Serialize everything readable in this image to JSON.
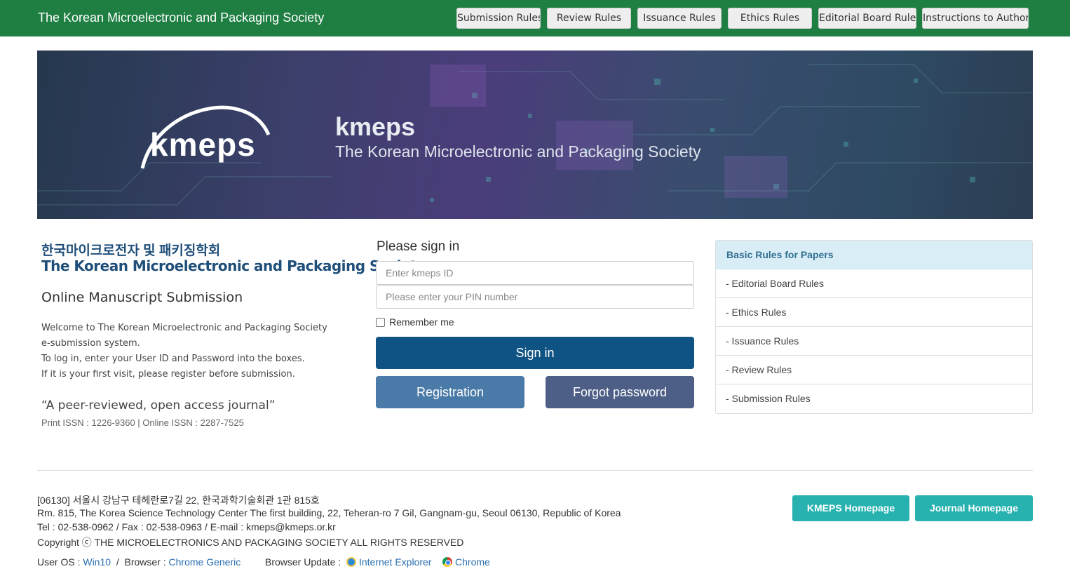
{
  "header": {
    "site_title": "The Korean Microelectronic and Packaging Society",
    "nav": [
      {
        "label": "Submission Rules"
      },
      {
        "label": "Review Rules"
      },
      {
        "label": "Issuance Rules"
      },
      {
        "label": "Ethics Rules"
      },
      {
        "label": "Editorial Board Rules"
      },
      {
        "label": "Instructions to Authors"
      }
    ]
  },
  "banner": {
    "logo_text": "kmeps",
    "brand": "kmeps",
    "subtitle": "The Korean Microelectronic and Packaging Society"
  },
  "intro": {
    "title_kr": "한국마이크로전자 및 패키징학회",
    "title_en": "The Korean Microelectronic and Packaging Society",
    "heading": "Online Manuscript Submission",
    "welcome_1": "Welcome to The Korean Microelectronic and Packaging Society e-submission system.",
    "welcome_2": "To log in, enter your User ID and Password into the boxes.",
    "welcome_3": "If it is your first visit, please register before submission.",
    "quote": "“A peer-reviewed, open access journal”",
    "issn": "Print ISSN : 1226-9360 | Online ISSN : 2287-7525"
  },
  "signin": {
    "title": "Please sign in",
    "id_placeholder": "Enter kmeps ID",
    "pin_placeholder": "Please enter your PIN number",
    "remember_label": "Remember me",
    "signin_label": "Sign in",
    "registration_label": "Registration",
    "forgot_label": "Forgot password"
  },
  "rules": {
    "title": "Basic Rules for Papers",
    "items": [
      {
        "label": "- Editorial Board Rules"
      },
      {
        "label": "- Ethics Rules"
      },
      {
        "label": "- Issuance Rules"
      },
      {
        "label": "- Review Rules"
      },
      {
        "label": "- Submission Rules"
      }
    ]
  },
  "footer": {
    "address_kr": "[06130] 서울시 강남구 테헤란로7길 22, 한국과학기술회관 1관 815호",
    "address_en": "Rm. 815, The Korea Science Technology Center The first building, 22, Teheran-ro 7 Gil, Gangnam-gu, Seoul 06130, Republic of Korea",
    "contact": "Tel : 02-538-0962 / Fax : 02-538-0963 / E-mail : kmeps@kmeps.or.kr",
    "copyright": "Copyright ⓒ THE MICROELECTRONICS AND PACKAGING SOCIETY ALL RIGHTS RESERVED",
    "kmeps_homepage": "KMEPS Homepage",
    "journal_homepage": "Journal Homepage",
    "env": {
      "os_label": "User OS :",
      "os_value": "Win10",
      "sep": "/",
      "browser_label": "Browser :",
      "browser_value": "Chrome Generic",
      "update_label": "Browser Update :",
      "ie": "Internet Explorer",
      "chrome": "Chrome"
    }
  },
  "colors": {
    "topbar": "#1f7f43",
    "primary": "#0e5383",
    "teal": "#27b2b0",
    "panel_head": "#d9edf7"
  }
}
